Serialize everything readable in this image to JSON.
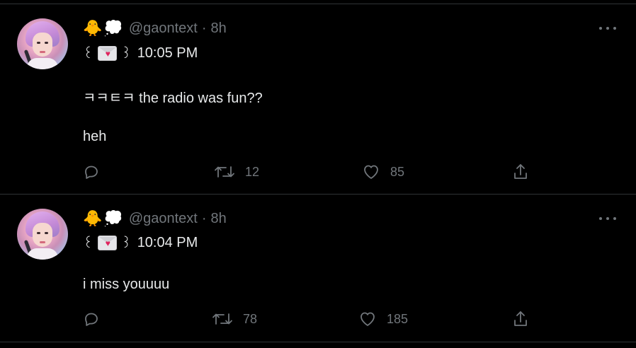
{
  "tweets": [
    {
      "handle": "@gaontext",
      "separator": "·",
      "time_ago": "8h",
      "name_emojis": [
        "🐥",
        "💭"
      ],
      "line1": {
        "open": "꒰",
        "envelope_icon": "love-letter-icon",
        "close": "꒱",
        "time": "10:05 PM"
      },
      "body": [
        "ㅋㅋㅌㅋ the radio was fun??",
        "heh"
      ],
      "actions": {
        "retweets": "12",
        "likes": "85"
      }
    },
    {
      "handle": "@gaontext",
      "separator": "·",
      "time_ago": "8h",
      "name_emojis": [
        "🐥",
        "💭"
      ],
      "line1": {
        "open": "꒰",
        "envelope_icon": "love-letter-icon",
        "close": "꒱",
        "time": "10:04 PM"
      },
      "body": [
        "i miss youuuu"
      ],
      "actions": {
        "retweets": "78",
        "likes": "185"
      }
    }
  ],
  "colors": {
    "background": "#000000",
    "text": "#e7e9ea",
    "muted": "#71767b",
    "divider": "#2f3336"
  }
}
